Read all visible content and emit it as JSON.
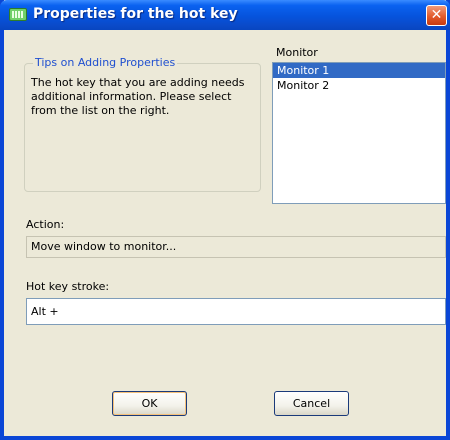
{
  "window": {
    "title": "Properties for the hot key",
    "close_symbol": "✕"
  },
  "tips": {
    "legend": "Tips on Adding Properties",
    "text": "The hot key that you are adding needs additional information. Please select from the list on the right."
  },
  "monitor": {
    "label": "Monitor",
    "items": [
      {
        "label": "Monitor 1",
        "selected": true
      },
      {
        "label": "Monitor 2",
        "selected": false
      }
    ]
  },
  "action": {
    "label": "Action:",
    "value": "Move window to monitor..."
  },
  "hotkey": {
    "label": "Hot key stroke:",
    "value": "Alt +"
  },
  "buttons": {
    "ok": "OK",
    "cancel": "Cancel"
  },
  "colors": {
    "titlebar": "#0a52d8",
    "selection": "#316ac5",
    "close": "#e35b2b",
    "dialog_bg": "#ece9d8"
  }
}
